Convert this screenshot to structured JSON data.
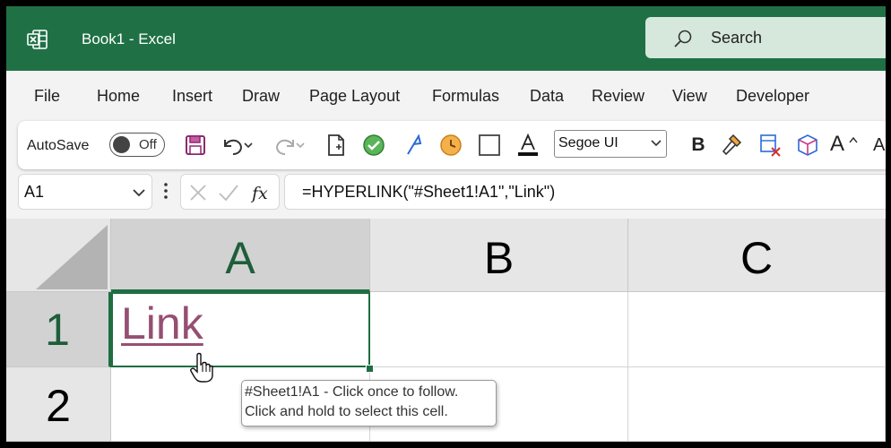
{
  "window": {
    "title": "Book1  -  Excel"
  },
  "search": {
    "label": "Search"
  },
  "menu": [
    "File",
    "Home",
    "Insert",
    "Draw",
    "Page Layout",
    "Formulas",
    "Data",
    "Review",
    "View",
    "Developer"
  ],
  "toolbar": {
    "autosave_label": "AutoSave",
    "autosave_state": "Off",
    "font_name": "Segoe UI",
    "icons": [
      "save-icon",
      "undo-icon",
      "redo-icon",
      "new-document-icon",
      "check-circle-icon",
      "pen-icon",
      "clock-icon",
      "border-icon",
      "font-color-icon",
      "bold-icon",
      "format-painter-icon",
      "clear-format-icon",
      "3d-box-icon",
      "increase-font-size-icon"
    ],
    "bold_label": "B",
    "font_size_label": "A"
  },
  "formula_bar": {
    "name_box": "A1",
    "formula": "=HYPERLINK(\"#Sheet1!A1\",\"Link\")"
  },
  "grid": {
    "columns": [
      "A",
      "B",
      "C"
    ],
    "rows": [
      "1",
      "2"
    ],
    "active_cell": "A1",
    "cell_a1_text": "Link"
  },
  "tooltip": {
    "line1": "#Sheet1!A1 - Click once to follow.",
    "line2": "Click and hold to select this cell."
  },
  "colors": {
    "title_bar": "#1f7145",
    "link": "#954f72",
    "selection": "#1e6e42"
  }
}
